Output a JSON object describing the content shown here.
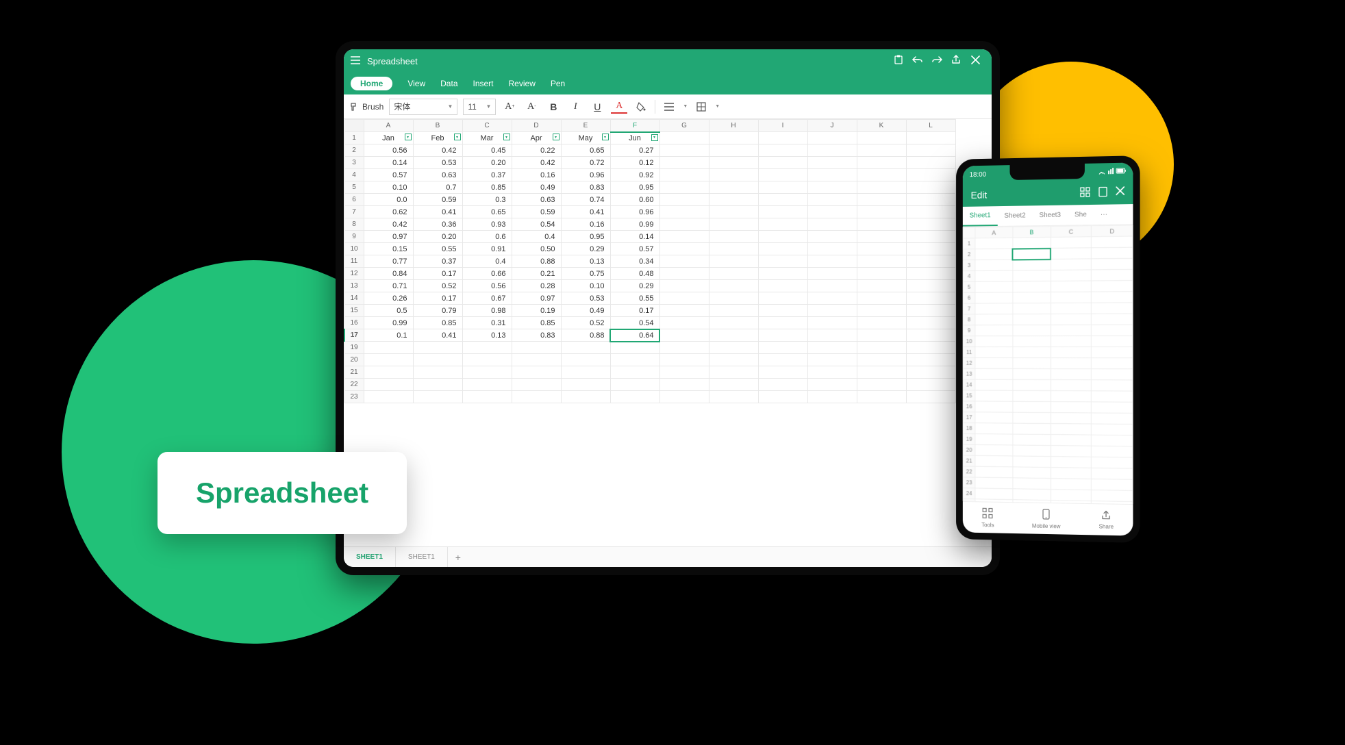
{
  "badge": {
    "label": "Spreadsheet"
  },
  "tablet": {
    "title": "Spreadsheet",
    "menu": {
      "tabs": [
        "Home",
        "View",
        "Data",
        "Insert",
        "Review",
        "Pen"
      ],
      "active": 0
    },
    "toolbar": {
      "brush": "Brush",
      "font": "宋体",
      "size": "11"
    },
    "columns": [
      "A",
      "B",
      "C",
      "D",
      "E",
      "F",
      "G",
      "H",
      "I",
      "J",
      "K",
      "L"
    ],
    "header_row": [
      "Jan",
      "Feb",
      "Mar",
      "Apr",
      "May",
      "Jun"
    ],
    "rows": [
      [
        "0.56",
        "0.42",
        "0.45",
        "0.22",
        "0.65",
        "0.27"
      ],
      [
        "0.14",
        "0.53",
        "0.20",
        "0.42",
        "0.72",
        "0.12"
      ],
      [
        "0.57",
        "0.63",
        "0.37",
        "0.16",
        "0.96",
        "0.92"
      ],
      [
        "0.10",
        "0.7",
        "0.85",
        "0.49",
        "0.83",
        "0.95"
      ],
      [
        "0.0",
        "0.59",
        "0.3",
        "0.63",
        "0.74",
        "0.60"
      ],
      [
        "0.62",
        "0.41",
        "0.65",
        "0.59",
        "0.41",
        "0.96"
      ],
      [
        "0.42",
        "0.36",
        "0.93",
        "0.54",
        "0.16",
        "0.99"
      ],
      [
        "0.97",
        "0.20",
        "0.6",
        "0.4",
        "0.95",
        "0.14"
      ],
      [
        "0.15",
        "0.55",
        "0.91",
        "0.50",
        "0.29",
        "0.57"
      ],
      [
        "0.77",
        "0.37",
        "0.4",
        "0.88",
        "0.13",
        "0.34"
      ],
      [
        "0.84",
        "0.17",
        "0.66",
        "0.21",
        "0.75",
        "0.48"
      ],
      [
        "0.71",
        "0.52",
        "0.56",
        "0.28",
        "0.10",
        "0.29"
      ],
      [
        "0.26",
        "0.17",
        "0.67",
        "0.97",
        "0.53",
        "0.55"
      ],
      [
        "0.5",
        "0.79",
        "0.98",
        "0.19",
        "0.49",
        "0.17"
      ],
      [
        "0.99",
        "0.85",
        "0.31",
        "0.85",
        "0.52",
        "0.54"
      ],
      [
        "0.1",
        "0.41",
        "0.13",
        "0.83",
        "0.88",
        "0.64"
      ]
    ],
    "blank_rows": [
      19,
      20,
      21,
      22,
      23
    ],
    "active_cell": {
      "row": 17,
      "col": 5
    },
    "sheets": {
      "tabs": [
        "SHEET1",
        "SHEET1"
      ],
      "active": 0
    }
  },
  "phone": {
    "status_time": "18:00",
    "header": "Edit",
    "tabs": [
      "Sheet1",
      "Sheet2",
      "Sheet3",
      "She",
      "···"
    ],
    "tabs_active": 0,
    "columns": [
      "A",
      "B",
      "C",
      "D"
    ],
    "row_count": 29,
    "active_col": 1,
    "active_cell": {
      "row": 2,
      "col": 1
    },
    "bottom": {
      "tools": "Tools",
      "mobile": "Mobile view",
      "share": "Share"
    }
  }
}
